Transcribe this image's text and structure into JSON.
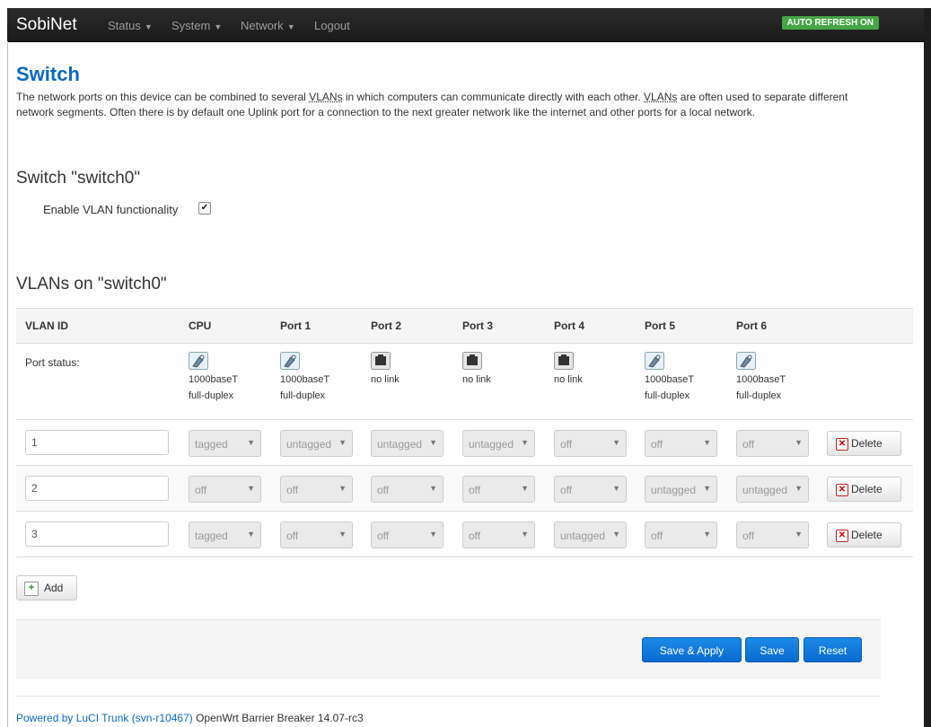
{
  "navbar": {
    "brand": "SobiNet",
    "menus": [
      "Status",
      "System",
      "Network"
    ],
    "logout": "Logout",
    "auto_refresh": "AUTO REFRESH ON"
  },
  "page": {
    "title": "Switch",
    "description_parts": [
      "The network ports on this device can be combined to several ",
      "VLANs",
      " in which computers can communicate directly with each other. ",
      "VLANs",
      " are often used to separate different network segments. Often there is by default one Uplink port for a connection to the next greater network like the internet and other ports for a local network."
    ]
  },
  "switch_section": {
    "heading": "Switch \"switch0\"",
    "enable_vlan_label": "Enable VLAN functionality",
    "enable_vlan_checked": true
  },
  "vlans": {
    "heading": "VLANs on \"switch0\"",
    "columns": [
      "VLAN ID",
      "CPU",
      "Port 1",
      "Port 2",
      "Port 3",
      "Port 4",
      "Port 5",
      "Port 6"
    ],
    "port_status_label": "Port status:",
    "port_status": [
      {
        "icon": "ethernet-connected-icon",
        "line1": "1000baseT",
        "line2": "full-duplex"
      },
      {
        "icon": "ethernet-connected-icon",
        "line1": "1000baseT",
        "line2": "full-duplex"
      },
      {
        "icon": "ethernet-nolink-icon",
        "line1": "no link",
        "line2": ""
      },
      {
        "icon": "ethernet-nolink-icon",
        "line1": "no link",
        "line2": ""
      },
      {
        "icon": "ethernet-nolink-icon",
        "line1": "no link",
        "line2": ""
      },
      {
        "icon": "ethernet-connected-icon",
        "line1": "1000baseT",
        "line2": "full-duplex"
      },
      {
        "icon": "ethernet-connected-icon",
        "line1": "1000baseT",
        "line2": "full-duplex"
      }
    ],
    "rows": [
      {
        "id": "1",
        "ports": [
          "tagged",
          "untagged",
          "untagged",
          "untagged",
          "off",
          "off",
          "off"
        ]
      },
      {
        "id": "2",
        "ports": [
          "off",
          "off",
          "off",
          "off",
          "off",
          "untagged",
          "untagged"
        ]
      },
      {
        "id": "3",
        "ports": [
          "tagged",
          "off",
          "off",
          "off",
          "untagged",
          "off",
          "off"
        ]
      }
    ],
    "delete_label": "Delete",
    "add_label": "Add"
  },
  "actions": {
    "save_apply": "Save & Apply",
    "save": "Save",
    "reset": "Reset"
  },
  "footer": {
    "link_text": "Powered by LuCI Trunk (svn-r10467)",
    "rest_text": " OpenWrt Barrier Breaker 14.07-rc3"
  },
  "colors": {
    "navbar": "#1f1f1f",
    "accent_blue": "#0a69c6",
    "auto_refresh_green": "#46a546",
    "primary_button": "#1a8ae8"
  }
}
